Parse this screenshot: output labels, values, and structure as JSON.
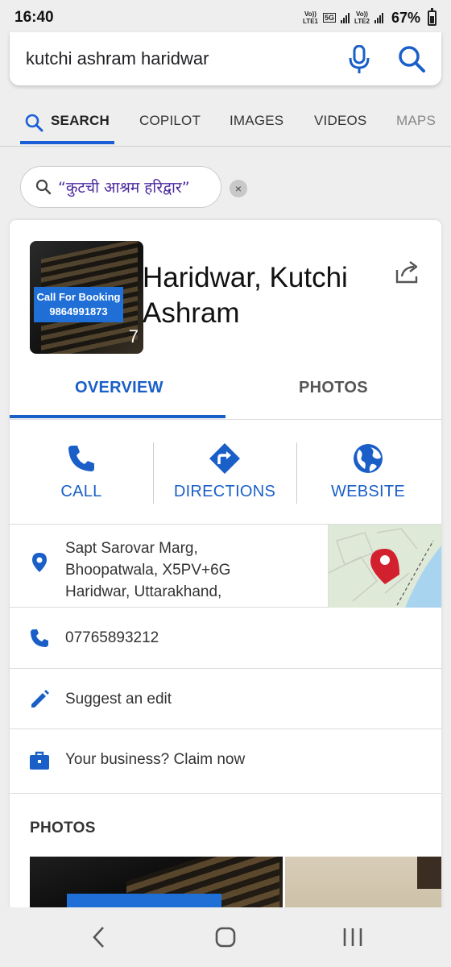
{
  "status": {
    "time": "16:40",
    "sim1": "LTE1",
    "sim2": "LTE2",
    "volte": "Vo))",
    "network_5g": "5G",
    "battery": "67%"
  },
  "search": {
    "query": "kutchi ashram haridwar"
  },
  "tabs": [
    {
      "label": "SEARCH"
    },
    {
      "label": "COPILOT"
    },
    {
      "label": "IMAGES"
    },
    {
      "label": "VIDEOS"
    },
    {
      "label": "MAPS"
    }
  ],
  "chip": {
    "text": "“कुटची आश्रम हरिद्वार”",
    "close": "×"
  },
  "place": {
    "title": "Haridwar, Kutchi Ashram",
    "thumb_badge": "Call For Booking\n9864991873",
    "thumb_count": "7"
  },
  "overview_tabs": {
    "overview": "OVERVIEW",
    "photos": "PHOTOS"
  },
  "actions": {
    "call": "CALL",
    "directions": "DIRECTIONS",
    "website": "WEBSITE"
  },
  "details": {
    "address": "Sapt Sarovar Marg, Bhoopatwala, X5PV+6G Haridwar, Uttarakhand,",
    "phone": "07765893212",
    "suggest": "Suggest an edit",
    "claim": "Your business? Claim now"
  },
  "photos_header": "PHOTOS",
  "colors": {
    "accent": "#1a5fc8",
    "tab_underline": "#1a5fd6",
    "chip_text": "#4b2aa0",
    "pin": "#d3202e"
  },
  "icons": [
    "search-icon",
    "mic-icon",
    "share-icon",
    "phone-icon",
    "directions-icon",
    "globe-icon",
    "location-pin-icon",
    "pencil-icon",
    "briefcase-icon",
    "back-icon",
    "home-icon",
    "recents-icon"
  ]
}
